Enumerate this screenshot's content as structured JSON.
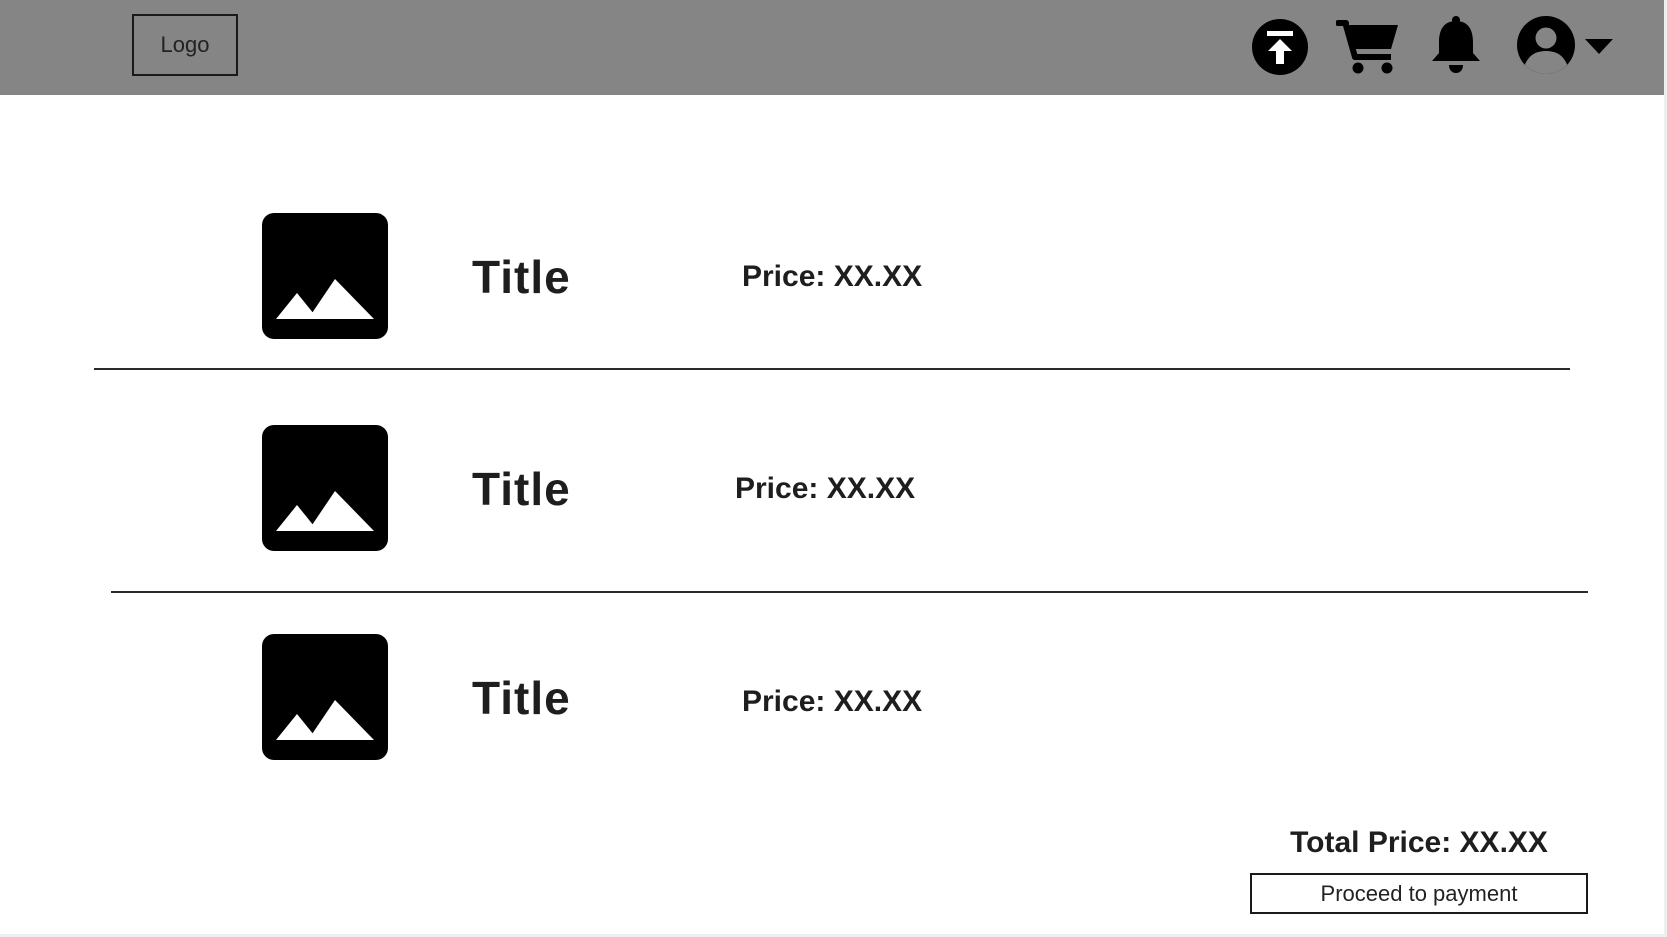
{
  "header": {
    "logo_label": "Logo",
    "icons": [
      "upload-icon",
      "cart-icon",
      "bell-icon",
      "user-avatar-icon",
      "chevron-down-icon"
    ]
  },
  "cart": {
    "items": [
      {
        "title": "Title",
        "price": "Price: XX.XX",
        "image_icon": "image-placeholder-icon"
      },
      {
        "title": "Title",
        "price": "Price: XX.XX",
        "image_icon": "image-placeholder-icon"
      },
      {
        "title": "Title",
        "price": "Price: XX.XX",
        "image_icon": "image-placeholder-icon"
      }
    ]
  },
  "summary": {
    "total_label": "Total Price: XX.XX",
    "pay_button_label": "Proceed to payment"
  },
  "colors": {
    "header_bg": "#858585",
    "text": "#1e1e1e",
    "icon": "#000000",
    "background": "#ffffff"
  }
}
